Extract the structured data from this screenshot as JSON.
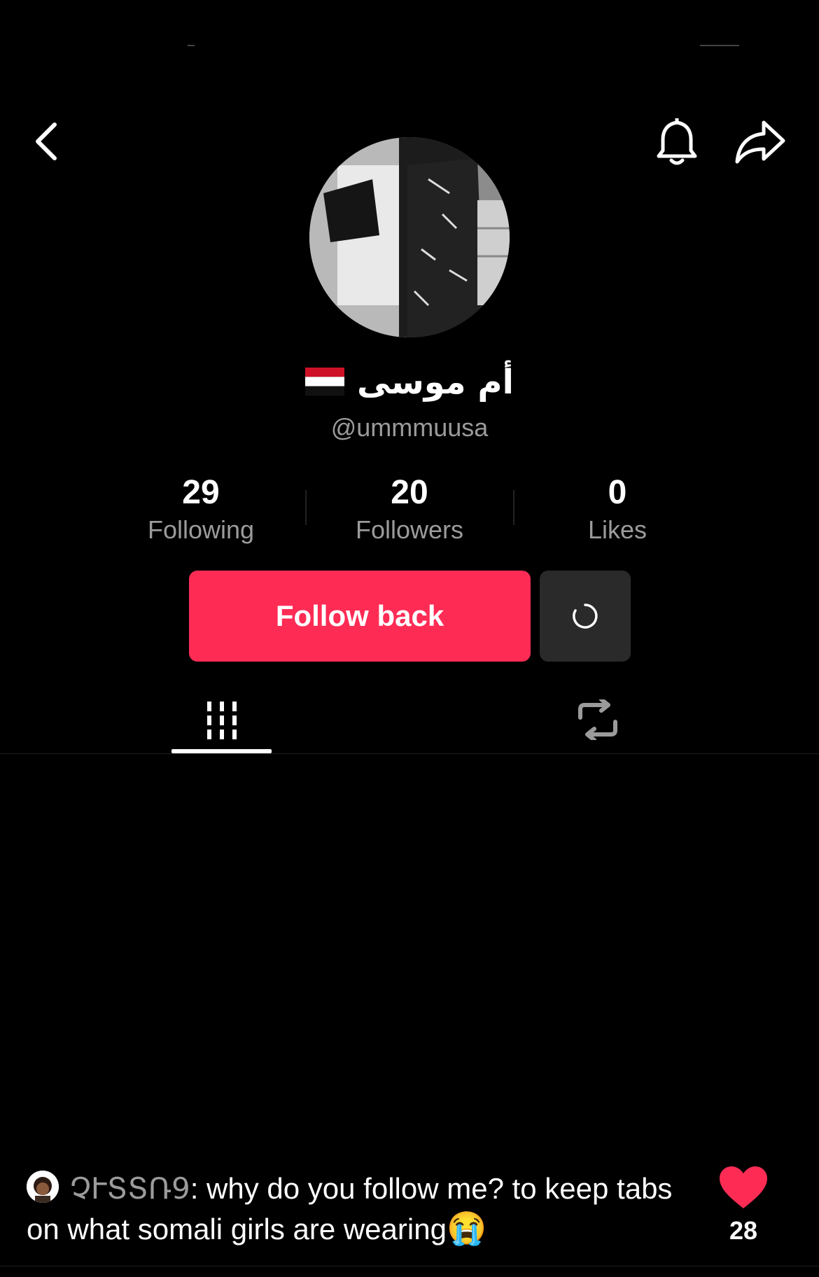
{
  "header": {
    "back_icon": "chevron-left-icon",
    "bell_icon": "bell-icon",
    "share_icon": "share-arrow-icon"
  },
  "profile": {
    "display_name": "أم موسى",
    "flag": "yemen-flag",
    "username": "@ummmuusa",
    "stats": [
      {
        "value": "29",
        "label": "Following"
      },
      {
        "value": "20",
        "label": "Followers"
      },
      {
        "value": "0",
        "label": "Likes"
      }
    ]
  },
  "actions": {
    "follow_label": "Follow back",
    "more_icon": "loading-spinner-icon"
  },
  "tabs": [
    {
      "icon": "grid-videos-icon",
      "active": true
    },
    {
      "icon": "repost-icon",
      "active": false
    }
  ],
  "comment": {
    "user": "ՉՒՏՏՌ9",
    "text": ": why do you follow me? to keep tabs on what somali girls are wearing",
    "emoji": "😭",
    "like_count": "28"
  },
  "colors": {
    "background": "#000000",
    "accent": "#fe2c55",
    "secondary_text": "#9b9b9b",
    "button_dark": "#2a2a2a"
  }
}
